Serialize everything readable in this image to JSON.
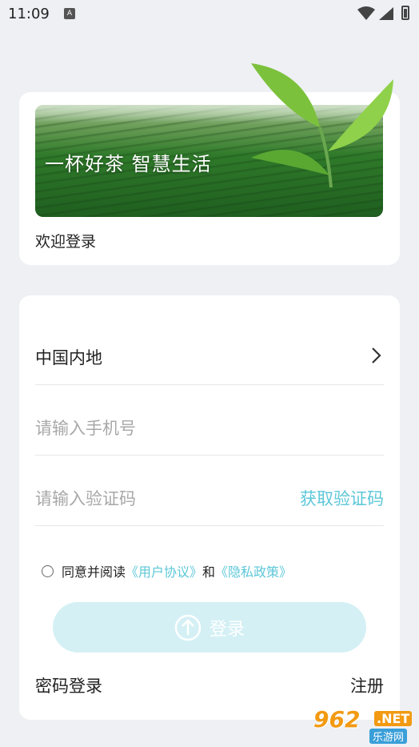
{
  "status_bar": {
    "time": "11:09",
    "sim_icon": "A"
  },
  "banner": {
    "slogan": "一杯好茶 智慧生活"
  },
  "welcome": "欢迎登录",
  "form": {
    "region": "中国内地",
    "phone_placeholder": "请输入手机号",
    "code_placeholder": "请输入验证码",
    "get_code": "获取验证码"
  },
  "agreement": {
    "prefix": "同意并阅读",
    "user_agreement": "《用户协议》",
    "and": "和",
    "privacy_policy": "《隐私政策》"
  },
  "login_label": "登录",
  "password_login": "密码登录",
  "register": "注册",
  "watermark": {
    "number": "962",
    "suffix": ".NET",
    "site": "乐游网"
  },
  "colors": {
    "accent": "#5cc7d8",
    "login_button_bg": "#d4f0f5",
    "background": "#eef0f4"
  }
}
